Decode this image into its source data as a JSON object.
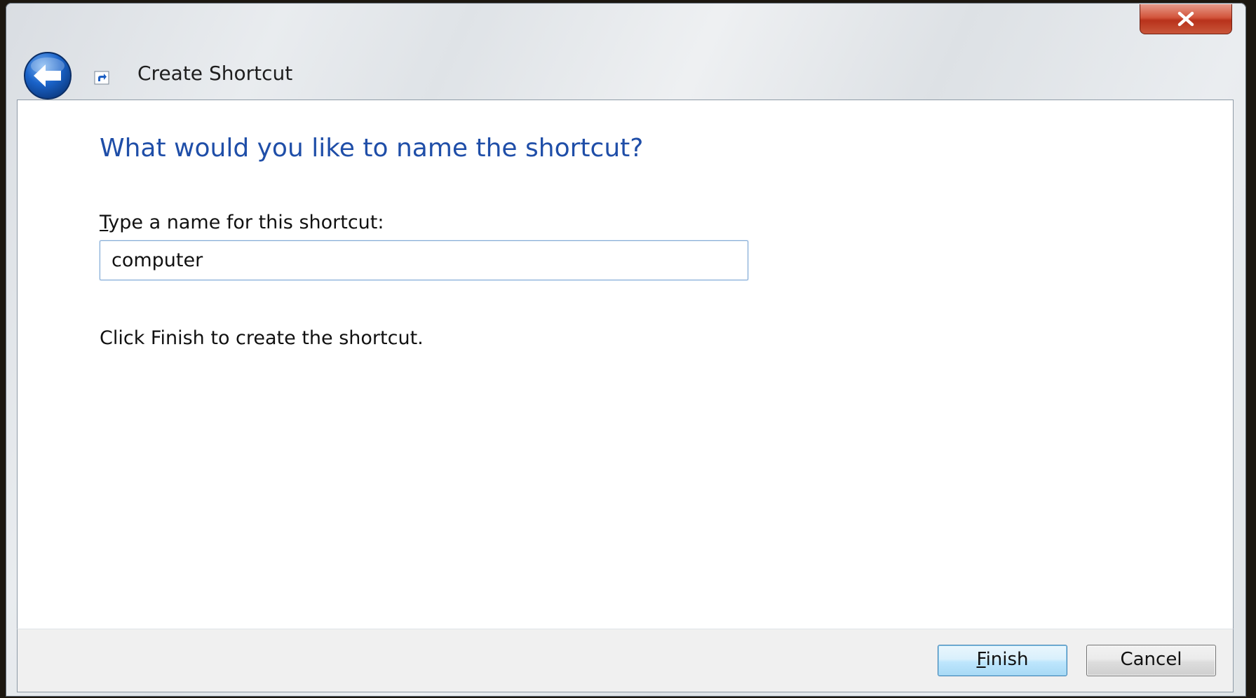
{
  "window": {
    "title": "Create Shortcut",
    "close_glyph": "✕"
  },
  "main": {
    "heading": "What would you like to name the shortcut?",
    "name_label_accel": "T",
    "name_label_rest": "ype a name for this shortcut:",
    "name_value": "computer",
    "info_text": "Click Finish to create the shortcut."
  },
  "footer": {
    "finish_accel": "F",
    "finish_rest": "inish",
    "cancel_label": "Cancel"
  },
  "colors": {
    "heading": "#1f4ea8",
    "close_button": "#c9563a",
    "back_button": "#1a63c9"
  },
  "icons": {
    "back": "back-arrow-icon",
    "shortcut": "shortcut-arrow-icon",
    "close": "close-icon"
  }
}
